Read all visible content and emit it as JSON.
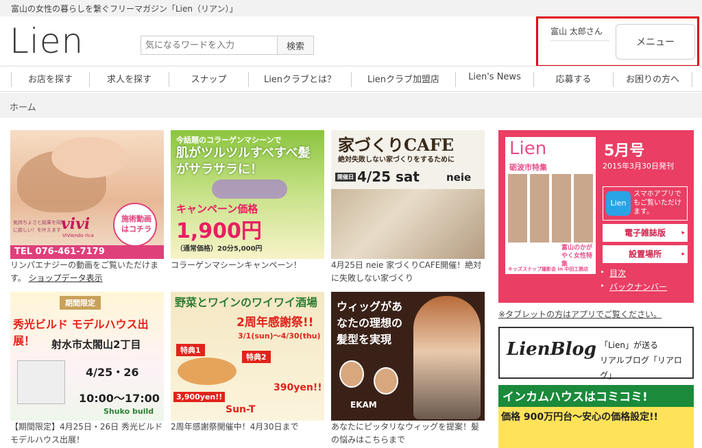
{
  "site": {
    "tagline": "富山の女性の暮らしを繋ぐフリーマガジン「Lien（リアン）」",
    "logo": "Lien"
  },
  "search": {
    "placeholder": "気になるワードを入力",
    "button": "検索"
  },
  "user": {
    "name": "富山 太郎さん",
    "menu_label": "メニュー"
  },
  "nav": {
    "items": [
      {
        "label": "お店を探す"
      },
      {
        "label": "求人を探す"
      },
      {
        "label": "スナップ"
      },
      {
        "label": "Lienクラブとは？"
      },
      {
        "label": "Lienクラブ加盟店"
      },
      {
        "label": "Lien's News"
      },
      {
        "label": "応募する"
      },
      {
        "label": "お困りの方へ"
      }
    ]
  },
  "breadcrumb": {
    "home": "ホーム"
  },
  "cards": [
    {
      "caption": "リンパエナジーの動画をご覧いただけます。",
      "link": "ショップデータ表示",
      "overlay": {
        "logo": "vivi",
        "sub": "ViViendo rica",
        "badge": "施術動画はコチラ",
        "tel": "TEL 076-461-7179",
        "note": "気持ちよさと結果を同時に欲しい！を叶えます"
      }
    },
    {
      "caption": "コラーゲンマシーンキャンペーン！",
      "overlay": {
        "top": "今話題のコラーゲンマシーンで",
        "main": "肌がツルツルすべすべ髪がサラサラに！",
        "campaign": "キャンペーン価格",
        "price": "1,900円",
        "regular": "（通常価格）20分5,000円"
      }
    },
    {
      "caption": "4月25日 neie 家づくりCAFE開催！絶対に失敗しない家づくり",
      "overlay": {
        "title": "家づくりCAFE",
        "sub": "絶対失敗しない家づくりをするために",
        "date_label": "開催日",
        "date": "4/25 sat",
        "brand": "neie"
      }
    },
    {
      "caption": "【期間限定】4月25日・26日 秀光ビルド モデルハウス出展！",
      "overlay": {
        "tag": "期間限定",
        "title": "秀光ビルド モデルハウス出展！",
        "place": "射水市太閤山2丁目",
        "date": "4/25・26",
        "time": "10:00～17:00",
        "brand": "Shuko build"
      }
    },
    {
      "caption": "2周年感謝祭開催中！4月30日まで",
      "overlay": {
        "title": "野菜とワインのワイワイ酒場",
        "sub": "2周年感謝祭!!",
        "period": "3/1(sun)～4/30(thu)",
        "tokuten1": "特典1",
        "tokuten2": "特典2",
        "price1": "3,900yen!!",
        "price2": "390yen!!",
        "brand": "Sun-T"
      }
    },
    {
      "caption": "あなたにピッタリなウィッグを提案！髪の悩みはこちらまで",
      "overlay": {
        "text": "ウィッグがあなたの理想の髪型を実現",
        "brand": "EKAM"
      }
    }
  ],
  "magazine": {
    "issue": "5月号",
    "date": "2015年3月30日発刊",
    "cover_logo": "Lien",
    "cover_feature": "砺波市特集",
    "cover_bottom": "富山のかがやく女性特集",
    "cover_footer": "キッズスナップ撮影会 in 中田工務店",
    "app_icon": "Lien",
    "app_text": "スマホアプリでもご覧いただけます。",
    "btn_ebook": "電子雑誌版",
    "btn_places": "設置場所",
    "link_toc": "目次",
    "link_back": "バックナンバー"
  },
  "tablet_note": "※タブレットの方はアプリでご覧ください。",
  "blog": {
    "logo": "LienBlog",
    "text1": "「Lien」が送る",
    "text2": "リアルブログ「リアログ」"
  },
  "income": {
    "title": "インカムハウスはコミコミ!",
    "sub": "価格 900万円台～安心の価格設定!!"
  },
  "colors": {
    "accent_red": "#e20012",
    "magazine_pink": "#ea3e64"
  }
}
